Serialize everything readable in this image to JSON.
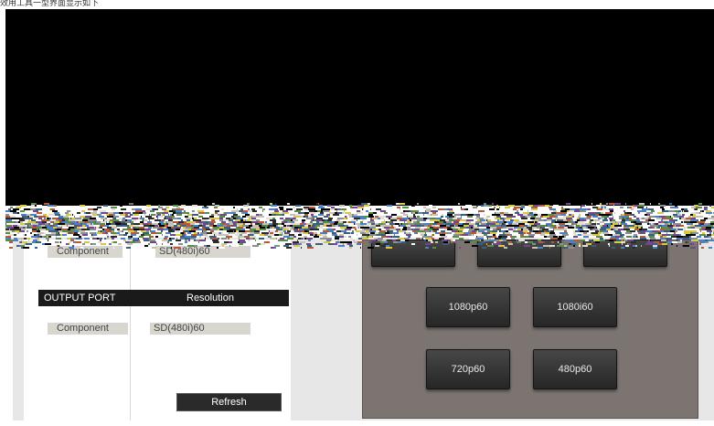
{
  "caption": "效用工具一型界面显示如下",
  "panel": {
    "top_row": {
      "port": "Component",
      "resolution": "SD(480i)60"
    },
    "output_header": {
      "port_label": "OUTPUT PORT",
      "resolution_label": "Resolution"
    },
    "output_row": {
      "port": "Component",
      "resolution": "SD(480i)60"
    },
    "refresh_label": "Refresh"
  },
  "resolution_buttons": {
    "btn_1080p60": "1080p60",
    "btn_1080i60": "1080i60",
    "btn_720p60": "720p60",
    "btn_480p60": "480p60"
  },
  "colors": {
    "right_panel_bg": "#7c7471",
    "button_bg": "#333333",
    "header_bg": "#1a1a1a",
    "label_bg": "#d9d6cf"
  }
}
